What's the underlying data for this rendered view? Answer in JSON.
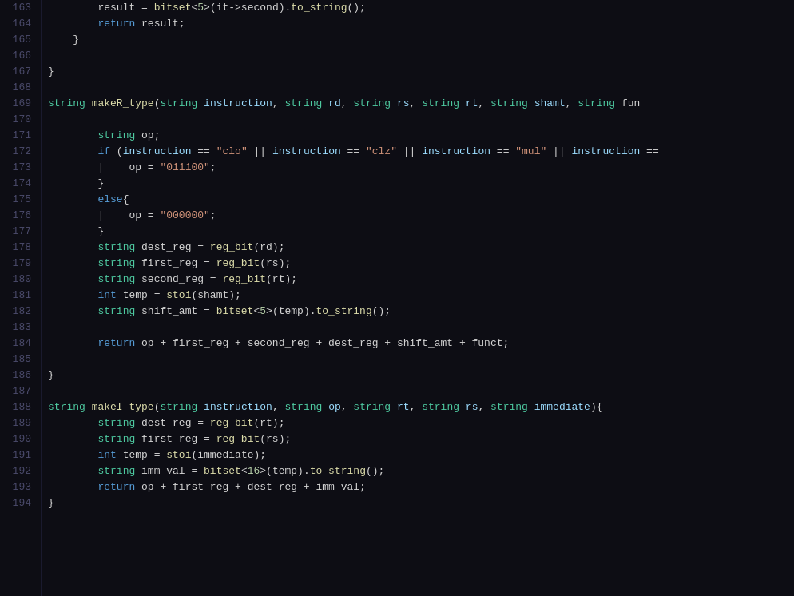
{
  "editor": {
    "background": "#0d0d14",
    "lines": [
      {
        "num": "163",
        "tokens": [
          {
            "text": "        result = bitset<5>(it->second).to_string();",
            "classes": "c-white"
          }
        ]
      },
      {
        "num": "164",
        "tokens": [
          {
            "text": "        return result;",
            "classes": "c-white"
          }
        ]
      },
      {
        "num": "165",
        "tokens": [
          {
            "text": "    }",
            "classes": "c-white"
          }
        ]
      },
      {
        "num": "166",
        "tokens": [
          {
            "text": "",
            "classes": "c-white"
          }
        ]
      },
      {
        "num": "167",
        "tokens": [
          {
            "text": "}",
            "classes": "c-white"
          }
        ]
      },
      {
        "num": "168",
        "tokens": [
          {
            "text": "",
            "classes": "c-white"
          }
        ]
      },
      {
        "num": "169",
        "tokens": [
          {
            "text": "string makeR_type(string instruction, string rd, string rs, string rt, string shamt, string fun",
            "classes": "c-white"
          }
        ]
      },
      {
        "num": "170",
        "tokens": [
          {
            "text": "",
            "classes": "c-white"
          }
        ]
      },
      {
        "num": "171",
        "tokens": [
          {
            "text": "    string op;",
            "classes": "c-white"
          }
        ]
      },
      {
        "num": "172",
        "tokens": [
          {
            "text": "    if (instruction == \"clo\" || instruction == \"clz\" || instruction == \"mul\" || instruction ==",
            "classes": "c-white"
          }
        ]
      },
      {
        "num": "173",
        "tokens": [
          {
            "text": "    |    op = \"011100\";",
            "classes": "c-white"
          }
        ]
      },
      {
        "num": "174",
        "tokens": [
          {
            "text": "    }",
            "classes": "c-white"
          }
        ]
      },
      {
        "num": "175",
        "tokens": [
          {
            "text": "    else{",
            "classes": "c-white"
          }
        ]
      },
      {
        "num": "176",
        "tokens": [
          {
            "text": "    |    op = \"000000\";",
            "classes": "c-white"
          }
        ]
      },
      {
        "num": "177",
        "tokens": [
          {
            "text": "    }",
            "classes": "c-white"
          }
        ]
      },
      {
        "num": "178",
        "tokens": [
          {
            "text": "    string dest_reg = reg_bit(rd);",
            "classes": "c-white"
          }
        ]
      },
      {
        "num": "179",
        "tokens": [
          {
            "text": "    string first_reg = reg_bit(rs);",
            "classes": "c-white"
          }
        ]
      },
      {
        "num": "180",
        "tokens": [
          {
            "text": "    string second_reg = reg_bit(rt);",
            "classes": "c-white"
          }
        ]
      },
      {
        "num": "181",
        "tokens": [
          {
            "text": "    int temp = stoi(shamt);",
            "classes": "c-white"
          }
        ]
      },
      {
        "num": "182",
        "tokens": [
          {
            "text": "    string shift_amt = bitset<5>(temp).to_string();",
            "classes": "c-white"
          }
        ]
      },
      {
        "num": "183",
        "tokens": [
          {
            "text": "",
            "classes": "c-white"
          }
        ]
      },
      {
        "num": "184",
        "tokens": [
          {
            "text": "    return op + first_reg + second_reg + dest_reg + shift_amt + funct;",
            "classes": "c-white"
          }
        ]
      },
      {
        "num": "185",
        "tokens": [
          {
            "text": "",
            "classes": "c-white"
          }
        ]
      },
      {
        "num": "186",
        "tokens": [
          {
            "text": "}",
            "classes": "c-white"
          }
        ]
      },
      {
        "num": "187",
        "tokens": [
          {
            "text": "",
            "classes": "c-white"
          }
        ]
      },
      {
        "num": "188",
        "tokens": [
          {
            "text": "string makeI_type(string instruction, string op, string rt, string rs, string immediate){",
            "classes": "c-white"
          }
        ]
      },
      {
        "num": "189",
        "tokens": [
          {
            "text": "    string dest_reg = reg_bit(rt);",
            "classes": "c-white"
          }
        ]
      },
      {
        "num": "190",
        "tokens": [
          {
            "text": "    string first_reg = reg_bit(rs);",
            "classes": "c-white"
          }
        ]
      },
      {
        "num": "191",
        "tokens": [
          {
            "text": "    int temp = stoi(immediate);",
            "classes": "c-white"
          }
        ]
      },
      {
        "num": "192",
        "tokens": [
          {
            "text": "    string imm_val = bitset<16>(temp).to_string();",
            "classes": "c-white"
          }
        ]
      },
      {
        "num": "193",
        "tokens": [
          {
            "text": "    return op + first_reg + dest_reg + imm_val;",
            "classes": "c-white"
          }
        ]
      },
      {
        "num": "194",
        "tokens": [
          {
            "text": "}",
            "classes": "c-white"
          }
        ]
      }
    ]
  }
}
